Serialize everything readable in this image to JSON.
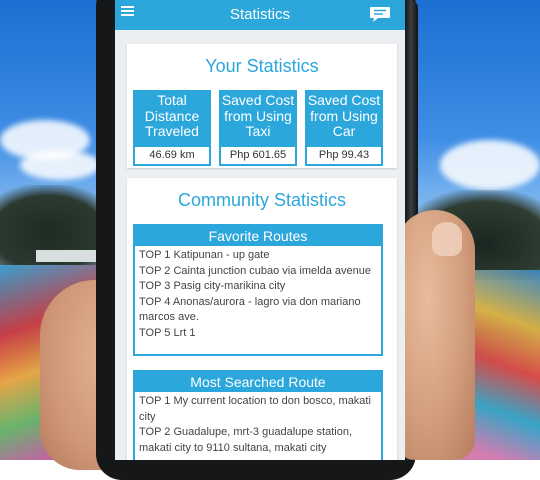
{
  "app_bar": {
    "title": "Statistics",
    "menu_icon": "hamburger-menu-icon",
    "chat_icon": "chat-bubble-icon",
    "color": "#2ba7dc"
  },
  "your_stats": {
    "title": "Your Statistics",
    "boxes": [
      {
        "label": "Total Distance Traveled",
        "value": "46.69 km"
      },
      {
        "label": "Saved Cost from Using Taxi",
        "value": "Php 601.65"
      },
      {
        "label": "Saved Cost from Using Car",
        "value": "Php 99.43"
      }
    ]
  },
  "community_stats": {
    "title": "Community Statistics",
    "favorite_routes": {
      "header": "Favorite Routes",
      "items": [
        "TOP 1 Katipunan - up gate",
        "TOP 2 Cainta junction cubao via imelda avenue",
        "TOP 3 Pasig city-marikina city",
        "TOP 4 Anonas/aurora - lagro via don mariano marcos ave.",
        "TOP 5 Lrt 1"
      ]
    },
    "most_searched": {
      "header": "Most Searched Route",
      "items": [
        "TOP 1 My current location to don bosco, makati city",
        "TOP 2 Guadalupe, mrt-3 guadalupe station, makati city to 9110 sultana, makati city"
      ]
    }
  }
}
